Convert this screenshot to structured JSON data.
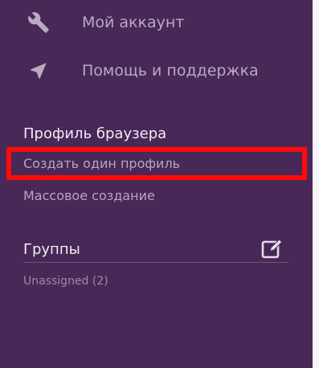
{
  "menu": {
    "items": [
      {
        "label": "Мой аккаунт",
        "icon": "wrench-icon"
      },
      {
        "label": "Помощь и поддержка",
        "icon": "location-arrow-icon"
      }
    ]
  },
  "browser_profile": {
    "title": "Профиль браузера",
    "create_one": "Создать один профиль",
    "bulk_create": "Массовое создание"
  },
  "groups": {
    "title": "Группы",
    "edit_icon": "edit-icon",
    "items": [
      {
        "label": "Unassigned (2)"
      }
    ]
  },
  "colors": {
    "sidebar_bg": "#472857",
    "highlight": "#ff0b0b",
    "text_muted": "#b9aac3",
    "text_bright": "#f1ecf4"
  }
}
